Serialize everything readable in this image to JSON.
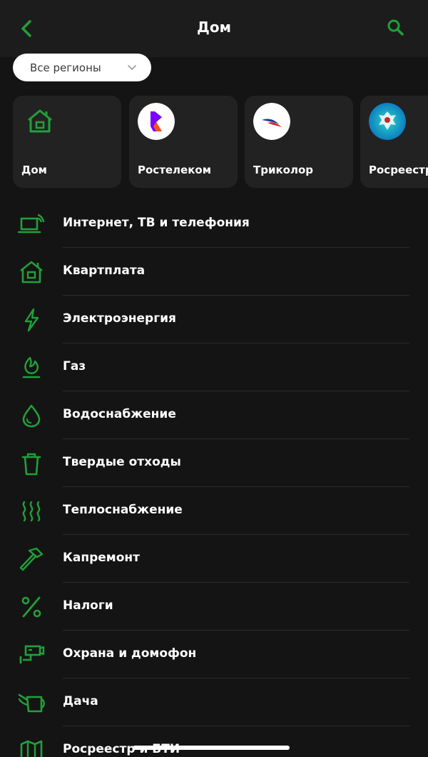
{
  "header": {
    "title": "Дом"
  },
  "region": {
    "label": "Все регионы"
  },
  "cards": [
    {
      "label": "Дом",
      "icon": "house-icon"
    },
    {
      "label": "Ростелеком",
      "icon": "rostelecom-logo"
    },
    {
      "label": "Триколор",
      "icon": "tricolor-logo"
    },
    {
      "label": "Росреестр",
      "icon": "rosreestr-logo"
    }
  ],
  "categories": [
    {
      "label": "Интернет, ТВ и телефония",
      "icon": "laptop-wifi-icon"
    },
    {
      "label": "Квартплата",
      "icon": "house-icon"
    },
    {
      "label": "Электроэнергия",
      "icon": "lightning-icon"
    },
    {
      "label": "Газ",
      "icon": "flame-icon"
    },
    {
      "label": "Водоснабжение",
      "icon": "water-drop-icon"
    },
    {
      "label": "Твердые отходы",
      "icon": "trash-icon"
    },
    {
      "label": "Теплоснабжение",
      "icon": "heat-waves-icon"
    },
    {
      "label": "Капремонт",
      "icon": "hammer-icon"
    },
    {
      "label": "Налоги",
      "icon": "percent-icon"
    },
    {
      "label": "Охрана и домофон",
      "icon": "security-camera-icon"
    },
    {
      "label": "Дача",
      "icon": "watering-can-icon"
    },
    {
      "label": "Росреестр и БТИ",
      "icon": "map-icon"
    }
  ],
  "colors": {
    "accent": "#21a038",
    "background": "#141414",
    "header": "#1c1c1c",
    "card": "#222222"
  }
}
